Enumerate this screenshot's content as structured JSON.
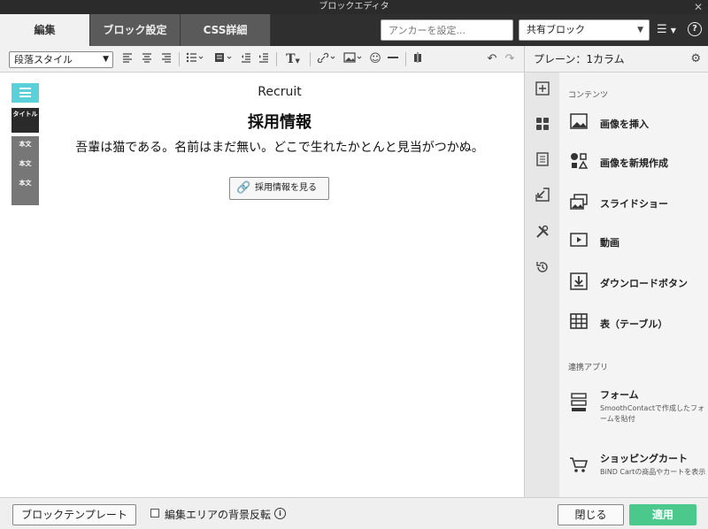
{
  "window": {
    "title": "ブロックエディタ",
    "close_glyph": "✕"
  },
  "tabs": [
    {
      "label": "編集",
      "active": true
    },
    {
      "label": "ブロック設定",
      "active": false
    },
    {
      "label": "CSS詳細",
      "active": false
    }
  ],
  "header": {
    "anchor_placeholder": "アンカーを設定...",
    "shared_block_value": "共有ブロック",
    "menu_glyph": "☰",
    "help_glyph": "?"
  },
  "toolbar": {
    "paragraph_style": "段落スタイル",
    "icons": [
      "align-left-icon",
      "align-center-icon",
      "align-right-icon",
      "list-icon",
      "block-icon",
      "indent-decrease-icon",
      "indent-increase-icon",
      "text-type-icon",
      "link-icon",
      "image-icon",
      "emoji-icon",
      "horizontal-rule-icon",
      "column-icon",
      "undo-icon",
      "redo-icon"
    ]
  },
  "block_panel": {
    "title": "プレーン：1カラム"
  },
  "block_indicators": {
    "title_label": "タイトル",
    "body_labels": [
      "本文",
      "本文",
      "本文"
    ]
  },
  "content": {
    "eyebrow": "Recruit",
    "title": "採用情報",
    "body": "吾輩は猫である。名前はまだ無い。どこで生れたかとんと見当がつかぬ。",
    "link_button": "採用情報を見る"
  },
  "side_rail": {
    "icons": [
      "add-block-icon",
      "grid-icon",
      "page-icon",
      "import-icon",
      "tools-icon",
      "history-icon"
    ]
  },
  "side_list": {
    "section_contents": "コンテンツ",
    "contents_items": [
      {
        "label": "画像を挿入",
        "icon": "image-icon"
      },
      {
        "label": "画像を新規作成",
        "icon": "shapes-icon"
      },
      {
        "label": "スライドショー",
        "icon": "slideshow-icon"
      },
      {
        "label": "動画",
        "icon": "video-icon"
      },
      {
        "label": "ダウンロードボタン",
        "icon": "download-icon"
      },
      {
        "label": "表（テーブル）",
        "icon": "table-icon"
      }
    ],
    "section_apps": "連携アプリ",
    "apps_items": [
      {
        "label": "フォーム",
        "desc": "SmoothContactで作成したフォームを貼付",
        "icon": "form-icon"
      },
      {
        "label": "ショッピングカート",
        "desc": "BiND Cartの商品やカートを表示",
        "icon": "cart-icon"
      }
    ]
  },
  "footer": {
    "template_button": "ブロックテンプレート",
    "bg_invert_label": "編集エリアの背景反転",
    "info_glyph": "i",
    "close_button": "閉じる",
    "apply_button": "適用"
  },
  "colors": {
    "apply_green": "#4bc88b",
    "title_indicator_cyan": "#5ad0d8",
    "tabbar_dark": "#2f2f2f"
  }
}
